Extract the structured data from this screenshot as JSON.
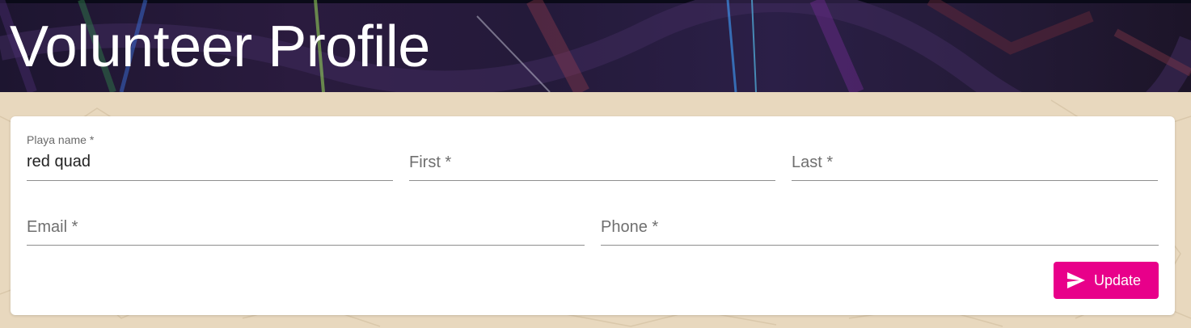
{
  "header": {
    "title": "Volunteer Profile"
  },
  "form": {
    "playa_name": {
      "label": "Playa name *",
      "value": "red quad"
    },
    "first": {
      "label": "First *",
      "value": ""
    },
    "last": {
      "label": "Last *",
      "value": ""
    },
    "email": {
      "label": "Email *",
      "value": ""
    },
    "phone": {
      "label": "Phone *",
      "value": ""
    },
    "update_button": {
      "label": "Update",
      "icon": "send-icon"
    }
  },
  "colors": {
    "accent": "#e8008a",
    "background": "#e8d8be",
    "header": "#2a1b3e"
  }
}
